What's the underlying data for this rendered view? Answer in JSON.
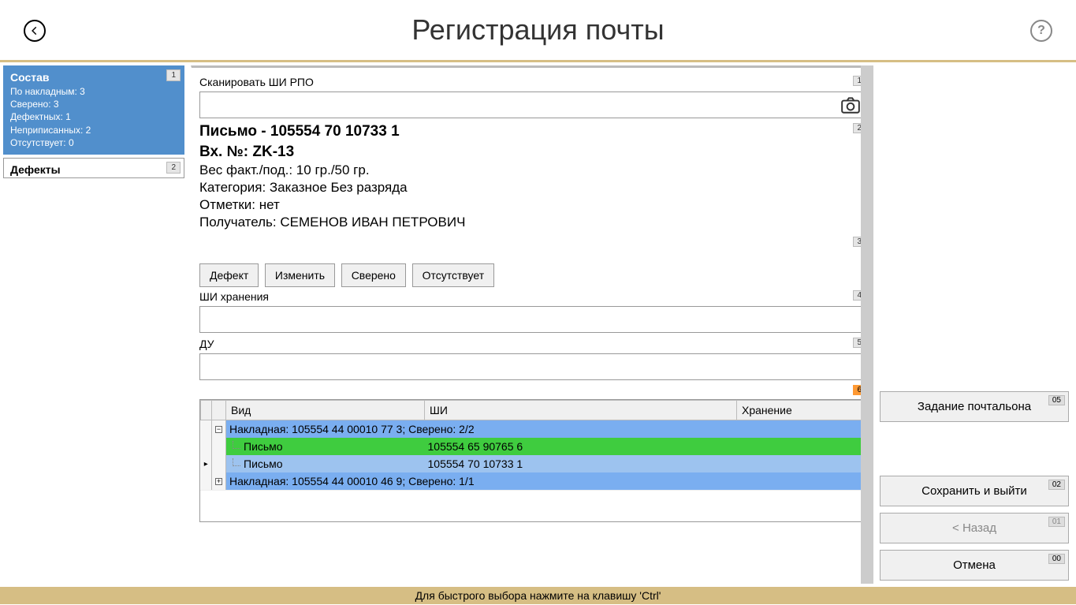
{
  "header": {
    "title": "Регистрация почты"
  },
  "left": {
    "composition": {
      "title": "Состав",
      "badge": "1",
      "lines": [
        "По накладным: 3",
        "Сверено: 3",
        "Дефектных: 1",
        "Неприписанных: 2",
        "Отсутствует: 0"
      ]
    },
    "defects": {
      "title": "Дефекты",
      "badge": "2"
    }
  },
  "center": {
    "scan_label": "Сканировать ШИ РПО",
    "scan_badge": "1",
    "scan_value": "",
    "letter_title": "Письмо - 105554 70 10733 1",
    "letter_badge": "2",
    "inbox": "Вх. №: ZK-13",
    "weight": "Вес факт./под.: 10 гр./50 гр.",
    "category": "Категория: Заказное Без разряда",
    "marks": "Отметки: нет",
    "recipient": "Получатель: СЕМЕНОВ ИВАН ПЕТРОВИЧ",
    "btn_badge": "3",
    "buttons": {
      "defect": "Дефект",
      "change": "Изменить",
      "verified": "Сверено",
      "absent": "Отсутствует"
    },
    "storage_label": "ШИ хранения",
    "storage_badge": "4",
    "storage_value": "",
    "du_label": "ДУ",
    "du_badge": "5",
    "du_value": "",
    "tree_badge": "6",
    "columns": {
      "kind": "Вид",
      "shi": "ШИ",
      "storage": "Хранение"
    },
    "rows": [
      {
        "type": "group",
        "expanded": true,
        "text": "Накладная: 105554 44 00010 77 3; Сверено: 2/2",
        "class": "row-blue"
      },
      {
        "type": "child",
        "kind": "Письмо",
        "shi": "105554 65 90765 6",
        "class": "row-green"
      },
      {
        "type": "child",
        "kind": "Письмо",
        "shi": "105554 70 10733 1",
        "class": "row-lblue",
        "current": true
      },
      {
        "type": "group",
        "expanded": false,
        "text": "Накладная: 105554 44 00010 46 9; Сверено: 1/1",
        "class": "row-blue"
      }
    ]
  },
  "right": {
    "postman": {
      "label": "Задание почтальона",
      "badge": "05"
    },
    "save": {
      "label": "Сохранить и выйти",
      "badge": "02"
    },
    "back": {
      "label": "< Назад",
      "badge": "01"
    },
    "cancel": {
      "label": "Отмена",
      "badge": "00"
    }
  },
  "footer": {
    "hint": "Для быстрого выбора нажмите на клавишу 'Ctrl'"
  }
}
